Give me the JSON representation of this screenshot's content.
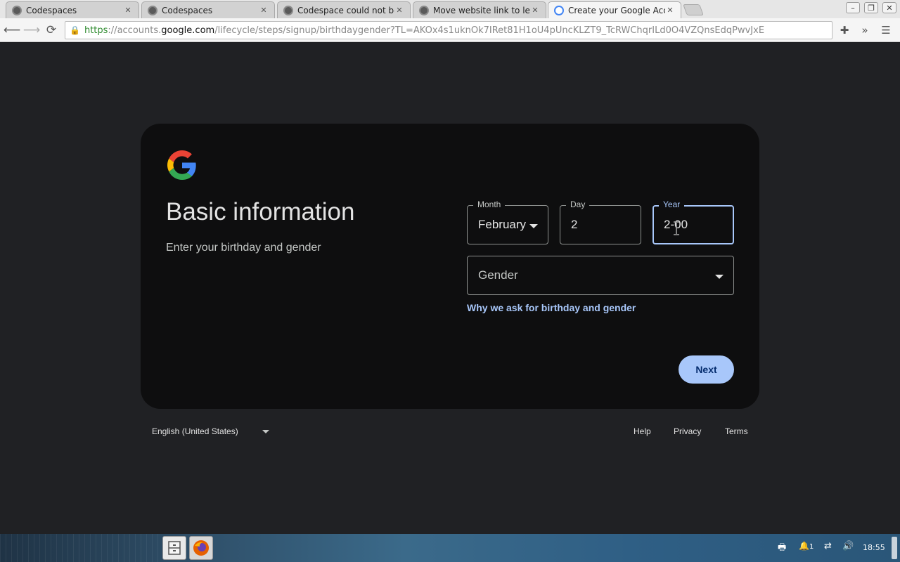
{
  "browser": {
    "tabs": [
      {
        "title": "Codespaces",
        "icon": "github-icon",
        "active": false
      },
      {
        "title": "Codespaces",
        "icon": "github-icon",
        "active": false
      },
      {
        "title": "Codespace could not be",
        "icon": "github-icon",
        "active": false
      },
      {
        "title": "Move website link to les",
        "icon": "github-icon",
        "active": false
      },
      {
        "title": "Create your Google Acco",
        "icon": "google-icon",
        "active": true
      }
    ],
    "url": {
      "scheme": "https",
      "sep": "://",
      "sub": "accounts.",
      "host": "google.com",
      "path": "/lifecycle/steps/signup/birthdaygender?TL=AKOx4s1uknOk7IRet81H1oU4pUncKLZT9_TcRWChqrILd0O4VZQnsEdqPwvJxE"
    }
  },
  "page": {
    "title": "Basic information",
    "subtitle": "Enter your birthday and gender",
    "month": {
      "label": "Month",
      "value": "February"
    },
    "day": {
      "label": "Day",
      "value": "2"
    },
    "year": {
      "label": "Year",
      "value": "2-00"
    },
    "gender": {
      "placeholder": "Gender"
    },
    "why_link": "Why we ask for birthday and gender",
    "next_label": "Next"
  },
  "footer": {
    "language": "English (United States)",
    "links": [
      "Help",
      "Privacy",
      "Terms"
    ]
  },
  "taskbar": {
    "clock": "18:55",
    "notifications": "1"
  },
  "colors": {
    "background": "#202124",
    "card": "#0e0e0f",
    "accent": "#a8c7fa",
    "text": "#e3e3e3"
  }
}
